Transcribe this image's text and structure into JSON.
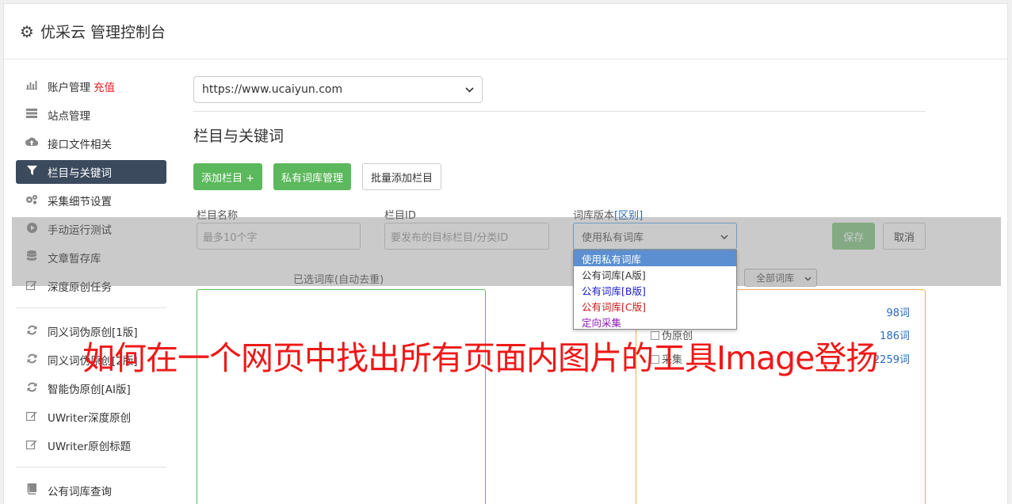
{
  "header": {
    "title": "优采云 管理控制台"
  },
  "sidebar": {
    "items": [
      {
        "label": "账户管理",
        "badge": "充值",
        "icon": "bar-chart-icon"
      },
      {
        "label": "站点管理",
        "icon": "server-icon"
      },
      {
        "label": "接口文件相关",
        "icon": "cloud-upload-icon"
      },
      {
        "label": "栏目与关键词",
        "icon": "filter-icon"
      },
      {
        "label": "采集细节设置",
        "icon": "cogs-icon"
      },
      {
        "label": "手动运行测试",
        "icon": "play-circle-icon"
      },
      {
        "label": "文章暂存库",
        "icon": "database-icon"
      },
      {
        "label": "深度原创任务",
        "icon": "edit-icon"
      },
      {
        "label": "同义词伪原创[1版]",
        "icon": "refresh-icon"
      },
      {
        "label": "同义词伪原创[2版]",
        "icon": "refresh-icon"
      },
      {
        "label": "智能伪原创[AI版]",
        "icon": "refresh-icon"
      },
      {
        "label": "UWriter深度原创",
        "icon": "edit-icon"
      },
      {
        "label": "UWriter原创标题",
        "icon": "edit-icon"
      },
      {
        "label": "公有词库查询",
        "icon": "book-icon"
      }
    ]
  },
  "main": {
    "site_select": "https://www.ucaiyun.com",
    "section_title": "栏目与关键词",
    "buttons": {
      "add_column": "添加栏目 +",
      "private_lib": "私有词库管理",
      "batch_add": "批量添加栏目"
    },
    "form": {
      "name_label": "栏目名称",
      "name_placeholder": "最多10个字",
      "id_label": "栏目ID",
      "id_placeholder": "要发布的目标栏目/分类ID",
      "version_label": "词库版本",
      "version_link": "[区别]",
      "version_value": "使用私有词库",
      "save": "保存",
      "cancel": "取消"
    },
    "selected_label": "已选词库(自动去重)",
    "lib_filter": "全部词库",
    "library_rows": [
      {
        "name": "",
        "count": "98词"
      },
      {
        "name": "伪原创",
        "count": "186词"
      },
      {
        "name": "采集",
        "count": "2259词"
      }
    ],
    "dropdown_options": [
      {
        "label": "使用私有词库",
        "color": "#ffffff"
      },
      {
        "label": "公有词库[A版]",
        "color": "#333333"
      },
      {
        "label": "公有词库[B版]",
        "color": "#1a1acc"
      },
      {
        "label": "公有词库[C版]",
        "color": "#cc1a1a"
      },
      {
        "label": "定向采集",
        "color": "#8a1ab0"
      }
    ]
  },
  "watermark": "如何在一个网页中找出所有页面内图片的工具Image登扬"
}
